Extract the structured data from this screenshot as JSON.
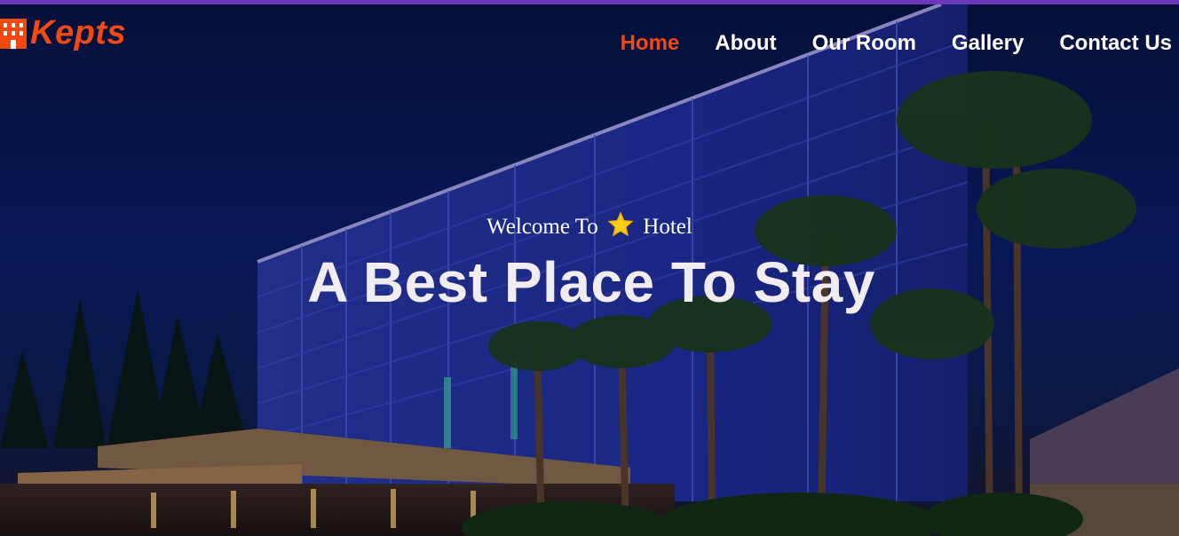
{
  "brand": {
    "name": "Kepts",
    "color": "#f04a12"
  },
  "nav": {
    "items": [
      {
        "label": "Home",
        "active": true
      },
      {
        "label": "About",
        "active": false
      },
      {
        "label": "Our Room",
        "active": false
      },
      {
        "label": "Gallery",
        "active": false
      },
      {
        "label": "Contact Us",
        "active": false
      }
    ]
  },
  "hero": {
    "welcome_before": "Welcome To",
    "welcome_icon": "star-icon",
    "welcome_after": "Hotel",
    "headline": "A Best Place To Stay"
  },
  "colors": {
    "accent": "#f04a12",
    "topbar": "#6a38b8",
    "text": "#ffffff"
  }
}
